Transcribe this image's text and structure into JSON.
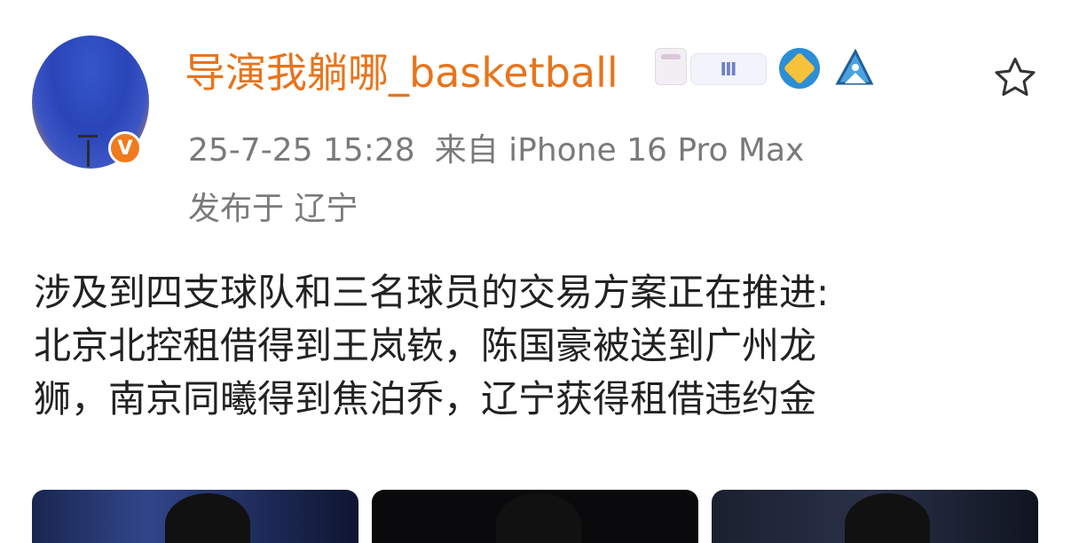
{
  "post": {
    "username": "导演我躺哪_basketball",
    "level_badge": "Ⅲ",
    "verified_badge": "V",
    "timestamp": "25-7-25 15:28",
    "source": "来自 iPhone 16 Pro Max",
    "location": "发布于 辽宁",
    "content_lines": [
      "涉及到四支球队和三名球员的交易方案正在推进:",
      "北京北控租借得到王岚嵚，陈国豪被送到广州龙",
      "狮，南京同曦得到焦泊乔，辽宁获得租借违约金"
    ]
  },
  "icons": {
    "favorite": "star-outline-icon",
    "badges": [
      "cake-badge-icon",
      "level-badge-icon",
      "shield-badge-icon",
      "whale-badge-icon"
    ]
  },
  "colors": {
    "username": "#e8741c",
    "meta": "#7a7a7a",
    "content": "#222222",
    "verified": "#f07a1f"
  }
}
